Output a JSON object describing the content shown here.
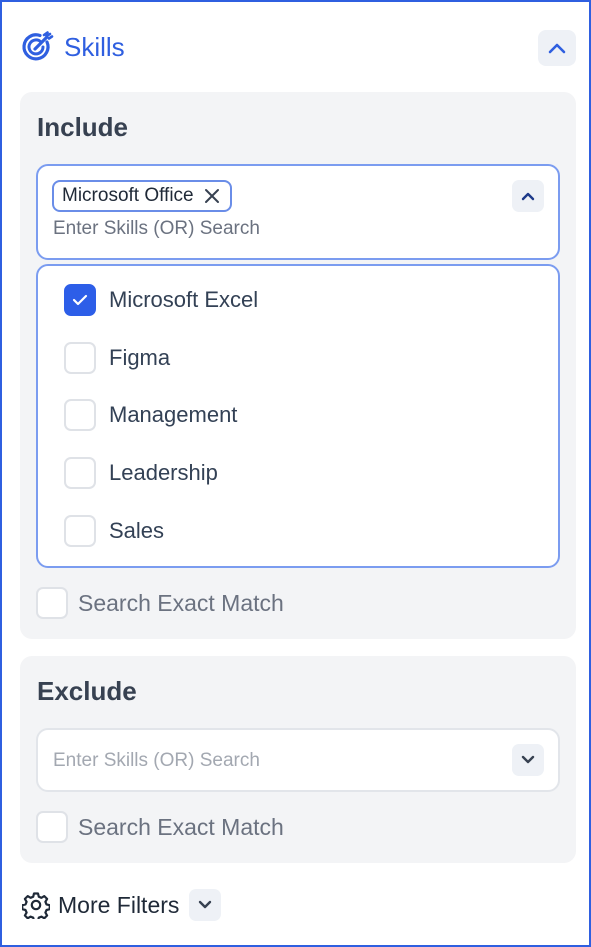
{
  "header": {
    "title": "Skills",
    "icon": "skills-target-icon"
  },
  "include": {
    "title": "Include",
    "chip": "Microsoft Office",
    "placeholder": "Enter Skills (OR) Search",
    "options": [
      {
        "label": "Microsoft Excel",
        "checked": true
      },
      {
        "label": "Figma",
        "checked": false
      },
      {
        "label": "Management",
        "checked": false
      },
      {
        "label": "Leadership",
        "checked": false
      },
      {
        "label": "Sales",
        "checked": false
      }
    ],
    "exact_label": "Search Exact Match"
  },
  "exclude": {
    "title": "Exclude",
    "placeholder": "Enter Skills (OR) Search",
    "exact_label": "Search Exact Match"
  },
  "more_filters": {
    "label": "More Filters",
    "icon": "gear-icon"
  },
  "colors": {
    "accent": "#2f5fe0",
    "section_bg": "#f3f4f6",
    "checked": "#2d5ee8"
  }
}
